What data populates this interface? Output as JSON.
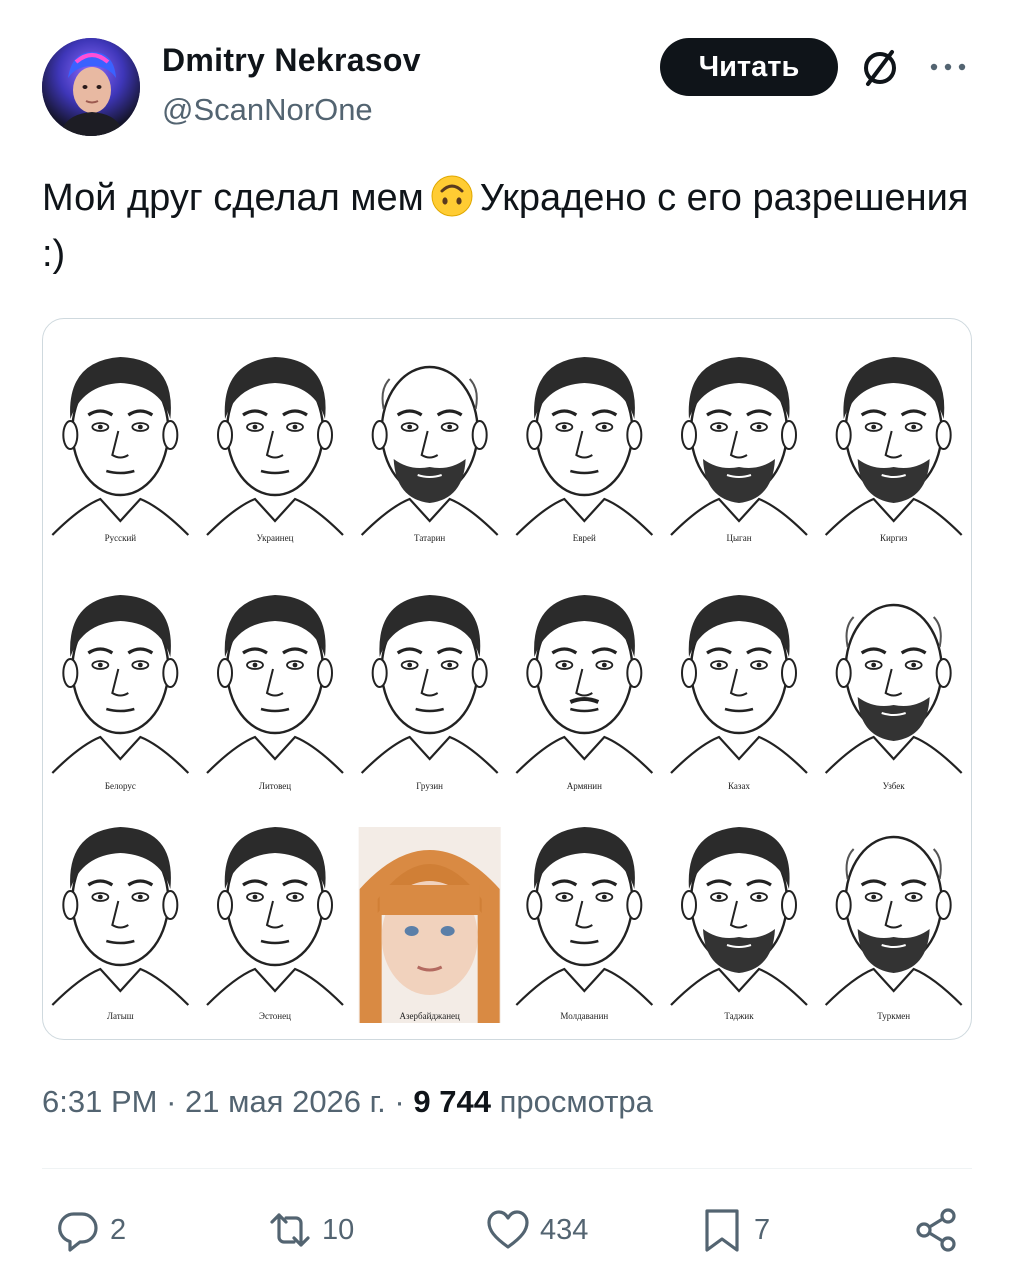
{
  "author": {
    "name": "Dmitry Nekrasov",
    "handle": "@ScanNorOne"
  },
  "header": {
    "follow_label": "Читать"
  },
  "tweet": {
    "text_before_emoji": "Мой друг сделал мем",
    "emoji": "upside-down-face",
    "text_after_emoji": "Украдено с его разрешения :)"
  },
  "media": {
    "captions": [
      [
        "Русский",
        "Украинец",
        "Татарин",
        "Еврей",
        "Цыган",
        "Киргиз"
      ],
      [
        "Белорус",
        "Литовец",
        "Грузин",
        "Армянин",
        "Казах",
        "Узбек"
      ],
      [
        "Латыш",
        "Эстонец",
        "Азербайджанец",
        "Молдаванин",
        "Таджик",
        "Туркмен"
      ]
    ]
  },
  "meta": {
    "time": "6:31 PM",
    "date": "21 мая 2026 г.",
    "views": "9 744",
    "views_label": "просмотра",
    "separator": "·"
  },
  "actions": {
    "replies": "2",
    "reposts": "10",
    "likes": "434",
    "bookmarks": "7"
  },
  "colors": {
    "text": "#0f1419",
    "secondary": "#536471",
    "border": "#cfd9de",
    "button_bg": "#0f1419"
  }
}
